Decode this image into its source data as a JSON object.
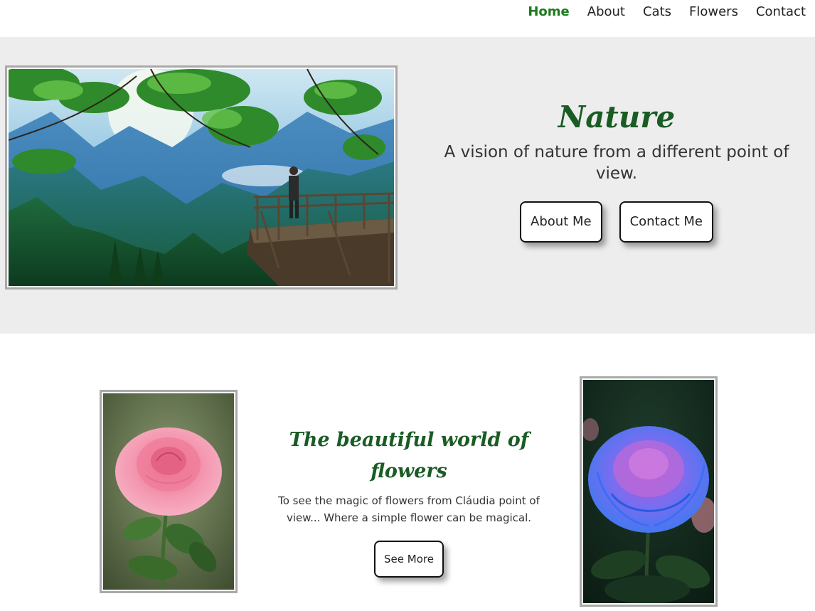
{
  "nav": {
    "items": [
      {
        "label": "Home",
        "active": true
      },
      {
        "label": "About",
        "active": false
      },
      {
        "label": "Cats",
        "active": false
      },
      {
        "label": "Flowers",
        "active": false
      },
      {
        "label": "Contact",
        "active": false
      }
    ]
  },
  "hero": {
    "title": "Nature",
    "subtitle": "A vision of nature from a different point of view.",
    "about_button": "About Me",
    "contact_button": "Contact Me"
  },
  "flowers": {
    "title": "The beautiful world of flowers",
    "description": "To see the magic of flowers from Cláudia point of view... Where a simple flower can be magical.",
    "button": "See More"
  },
  "colors": {
    "accent": "#1a5c24",
    "active_nav": "#1c7a1c",
    "hero_bg": "#ededed",
    "frame": "#a9a9a9"
  }
}
